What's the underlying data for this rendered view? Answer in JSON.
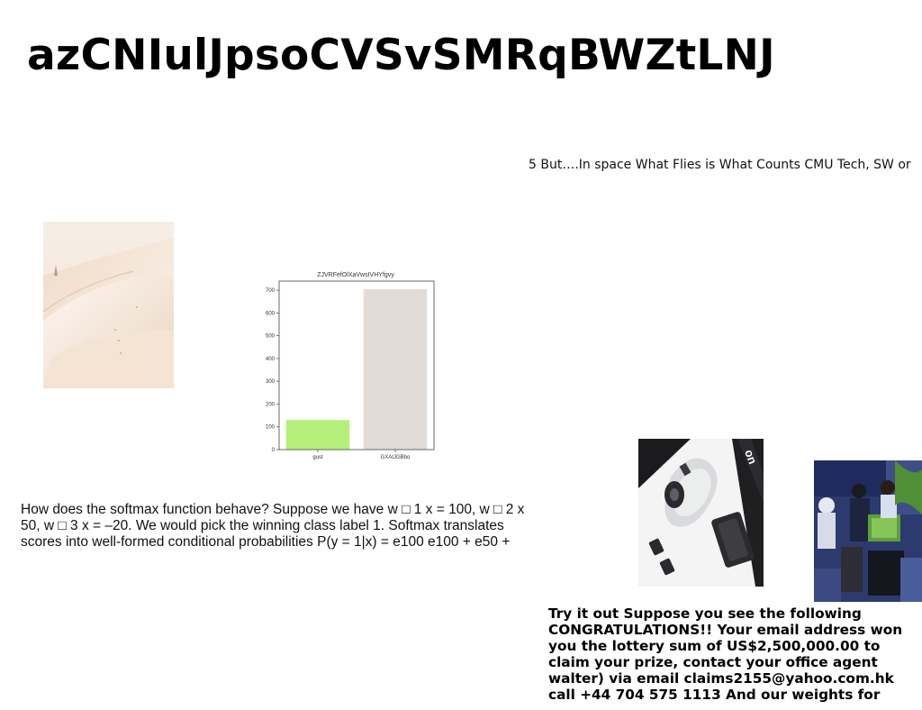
{
  "page": {
    "title": "azCNIulJpsoCVSvSMRqBWZtLNJ",
    "tagline": "5 But….In space What Flies is What Counts CMU Tech, SW or",
    "softmax_text": "How does the softmax function behave? Suppose we have w □ 1 x = 100, w □ 2 x 50, w □ 3 x = –20. We would pick the winning class label 1. Softmax translates scores into well-formed conditional probabilities P(y = 1|x) = e100 e100 + e50 +",
    "lottery_text": "Try it out Suppose you see the following CONGRATULATIONS!! Your email address won you the lottery sum of US$2,500,000.00 to claim your prize, contact your office agent walter) via email claims2155@yahoo.com.hk call +44 704 575 1113 And our weights for"
  },
  "chart_data": {
    "type": "bar",
    "title": "ZJVRFefOlXaVwsIVHYfgvy",
    "categories": [
      "gust",
      "GXAtJGBbo"
    ],
    "values": [
      130,
      705
    ],
    "colors": [
      "#b5f07c",
      "#e2dcd8"
    ],
    "xlabel": "",
    "ylabel": "",
    "ylim": [
      0,
      740
    ],
    "yticks": [
      0,
      100,
      200,
      300,
      400,
      500,
      600,
      700
    ],
    "grid": false
  }
}
